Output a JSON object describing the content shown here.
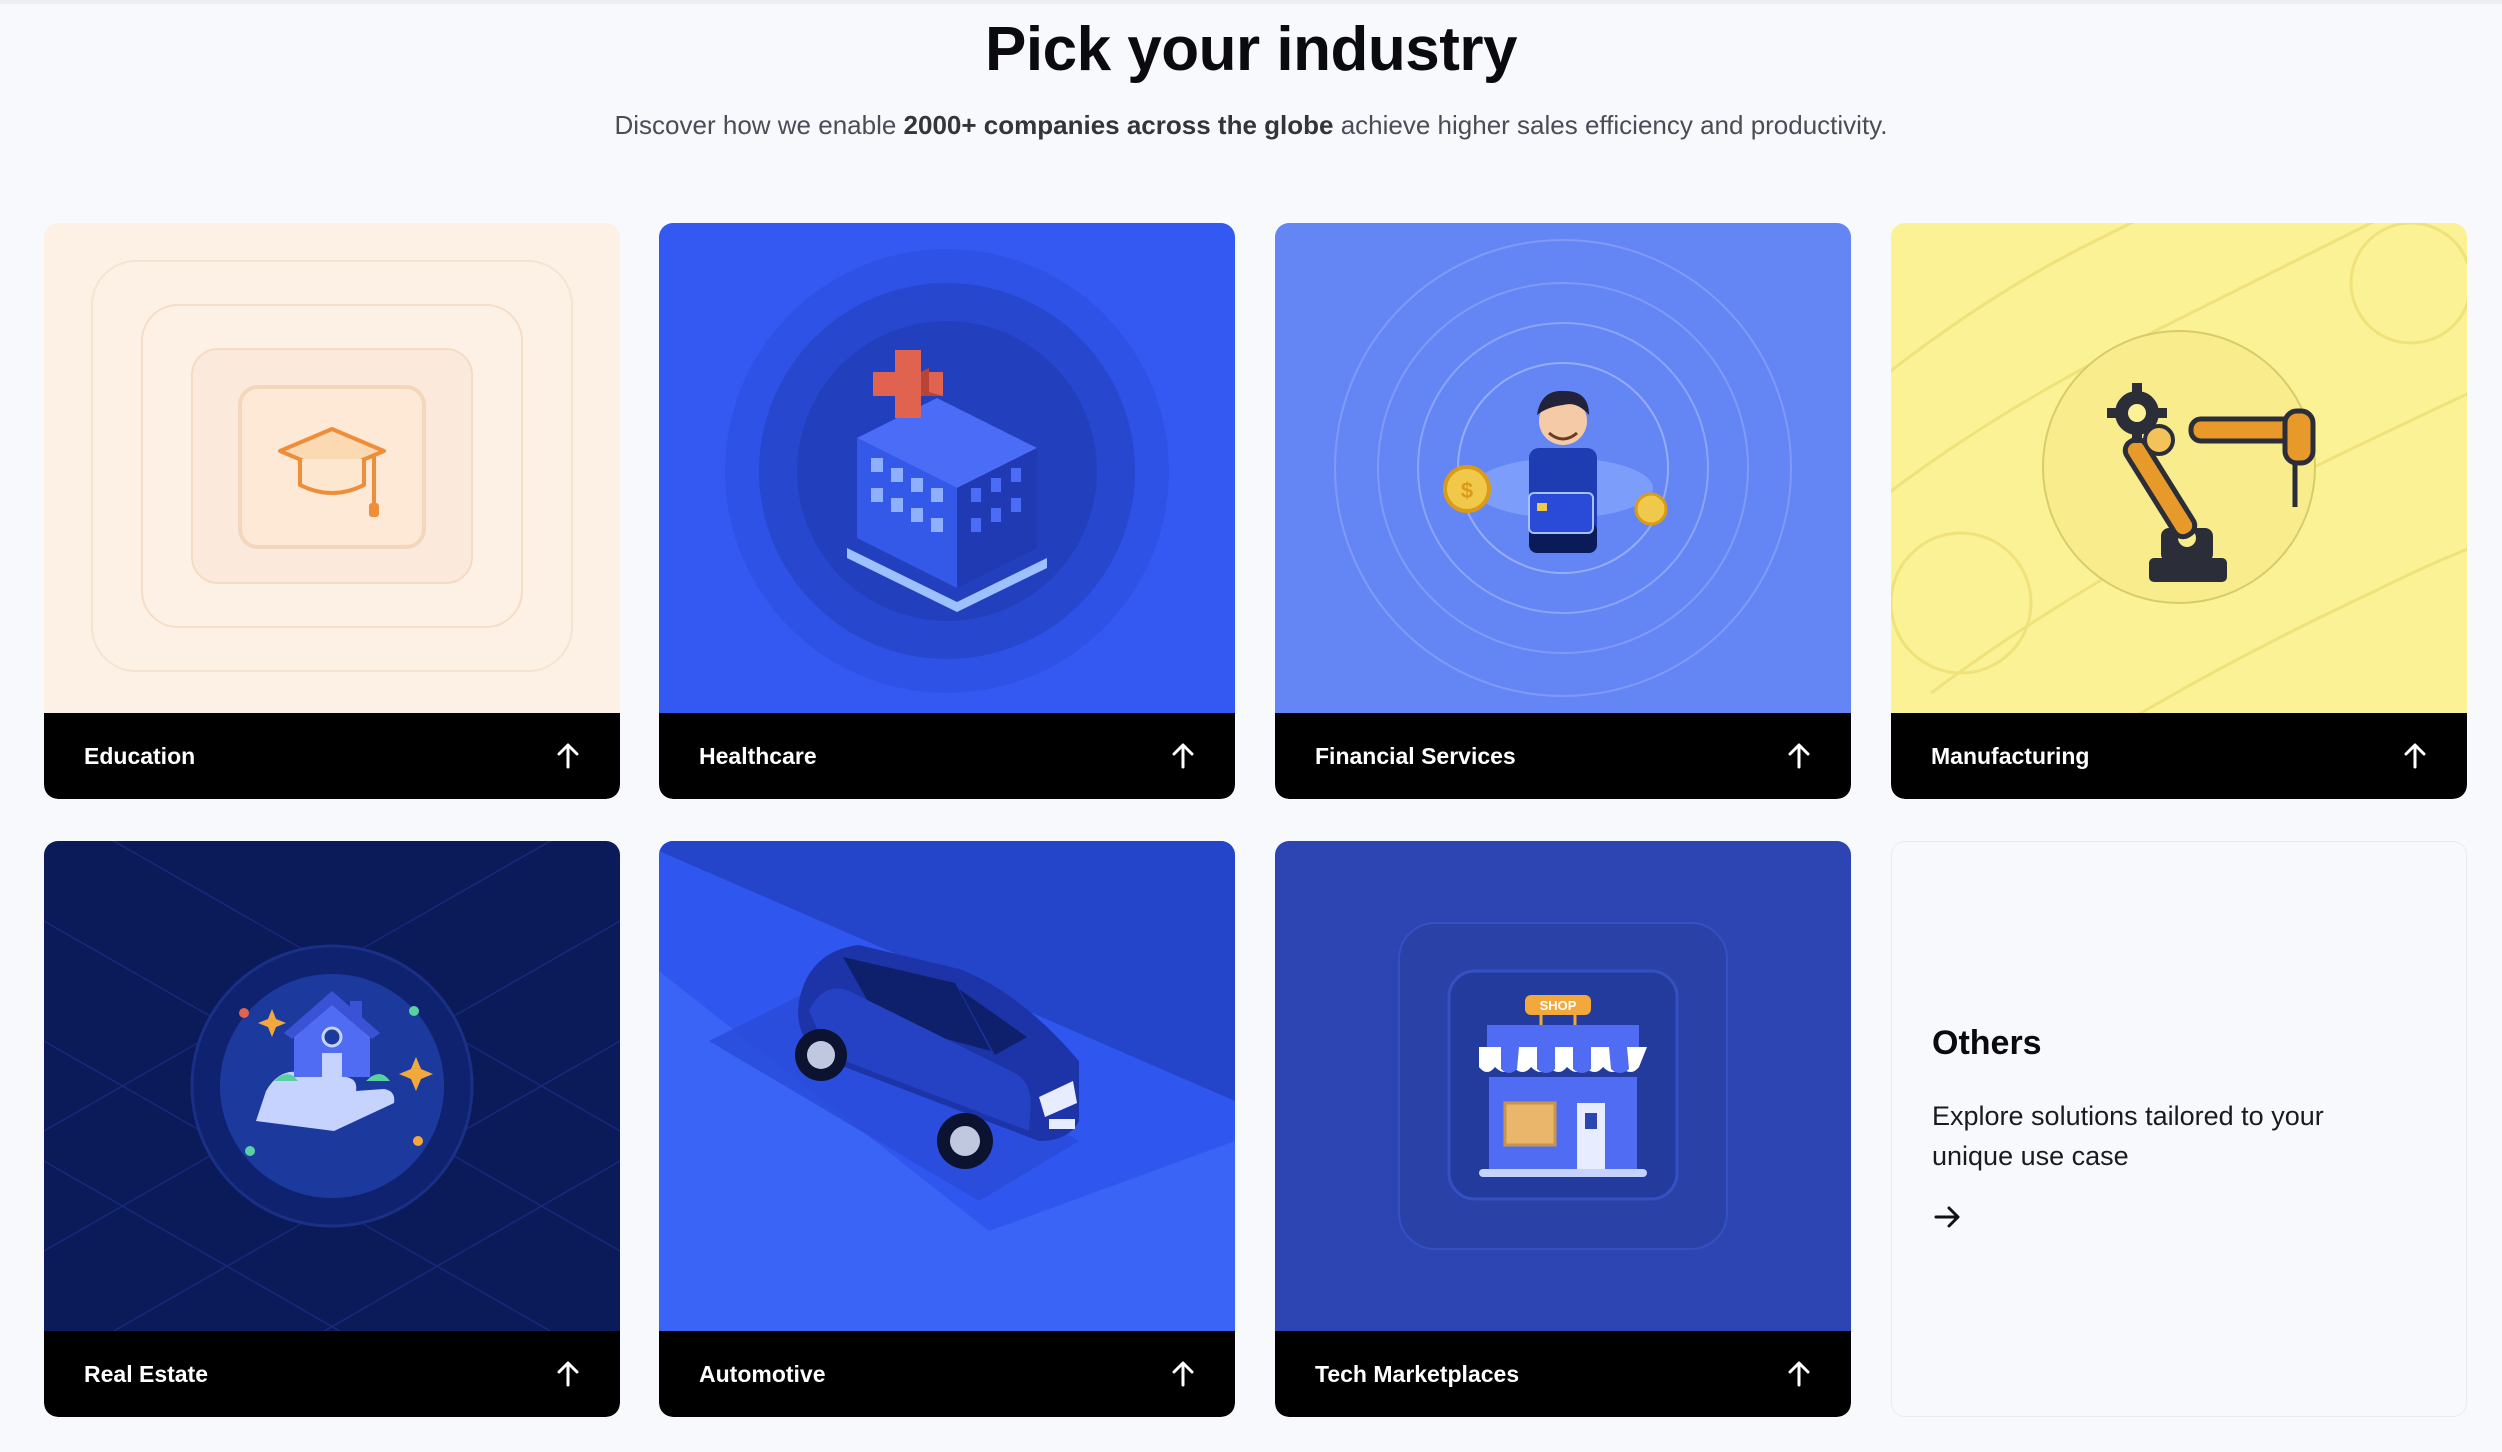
{
  "header": {
    "title": "Pick your industry",
    "subtitle_before": "Discover how we enable ",
    "subtitle_bold": "2000+ companies across the globe",
    "subtitle_after": " achieve higher sales efficiency and productivity."
  },
  "industries": [
    {
      "label": "Education",
      "icon": "graduation-cap-icon",
      "bg": "#fdf1e6"
    },
    {
      "label": "Healthcare",
      "icon": "hospital-building-icon",
      "bg": "#3359f2"
    },
    {
      "label": "Financial Services",
      "icon": "banker-with-coins-icon",
      "bg": "#6486f4"
    },
    {
      "label": "Manufacturing",
      "icon": "robot-arm-icon",
      "bg": "#fbf296"
    },
    {
      "label": "Real Estate",
      "icon": "house-in-hand-icon",
      "bg": "#0b1a58"
    },
    {
      "label": "Automotive",
      "icon": "car-icon",
      "bg": "#2f56ee"
    },
    {
      "label": "Tech Marketplaces",
      "icon": "shop-storefront-icon",
      "bg": "#2c45b3"
    }
  ],
  "shop_sign": "SHOP",
  "others": {
    "title": "Others",
    "description": "Explore solutions tailored to your unique use case"
  },
  "icons": {
    "card_arrow": "arrow-up-icon",
    "others_arrow": "arrow-right-icon"
  }
}
